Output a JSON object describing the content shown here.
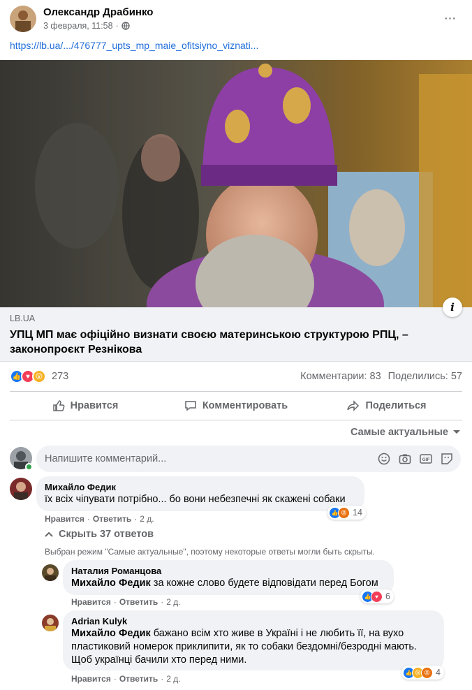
{
  "post": {
    "author": "Олександр Драбинко",
    "date": "3 февраля, 11:58",
    "separator": "·",
    "link_text": "https://lb.ua/.../476777_upts_mp_maie_ofitsiyno_viznati...",
    "link_preview": {
      "domain": "LB.UA",
      "title": "УПЦ МП має офіційно визнати своєю материнською структурою РПЦ, – законопроєкт Резнікова"
    },
    "reaction_count": "273",
    "comments_count": "Комментарии: 83",
    "shares_count": "Поделились: 57"
  },
  "actions": {
    "like": "Нравится",
    "comment": "Комментировать",
    "share": "Поделиться"
  },
  "sort_label": "Самые актуальные",
  "composer_placeholder": "Напишите комментарий...",
  "comments": [
    {
      "name": "Михайло Федик",
      "text": "їх всіх чіпувати потрібно... бо вони небезпечні як скажені собаки",
      "like": "Нравится",
      "reply": "Ответить",
      "age": "2 д.",
      "reaction_count": "14"
    }
  ],
  "hide_replies": "Скрыть 37 ответов",
  "mode_note": "Выбран режим \"Самые актуальные\", поэтому некоторые ответы могли быть скрыты.",
  "replies": [
    {
      "name": "Наталия Романцова",
      "tag": "Михайло Федик",
      "text": " за кожне слово будете відповідати перед Богом",
      "like": "Нравится",
      "reply": "Ответить",
      "age": "2 д.",
      "reaction_count": "6"
    },
    {
      "name": "Adrian Kulyk",
      "tag": "Михайло Федик",
      "text": " бажано всім хто живе в Україні і не любить її, на вухо пластиковий номерок приклипити, як то собаки бездомні/безродні мають. Щоб українці бачили хто перед ними.",
      "like": "Нравится",
      "reply": "Ответить",
      "age": "2 д.",
      "reaction_count": "4"
    }
  ],
  "colors": {
    "link": "#216fdb",
    "like_blue": "#1877f2",
    "love_red": "#f33e58",
    "wow_yellow": "#f7b125",
    "secondary_text": "#65676b"
  }
}
